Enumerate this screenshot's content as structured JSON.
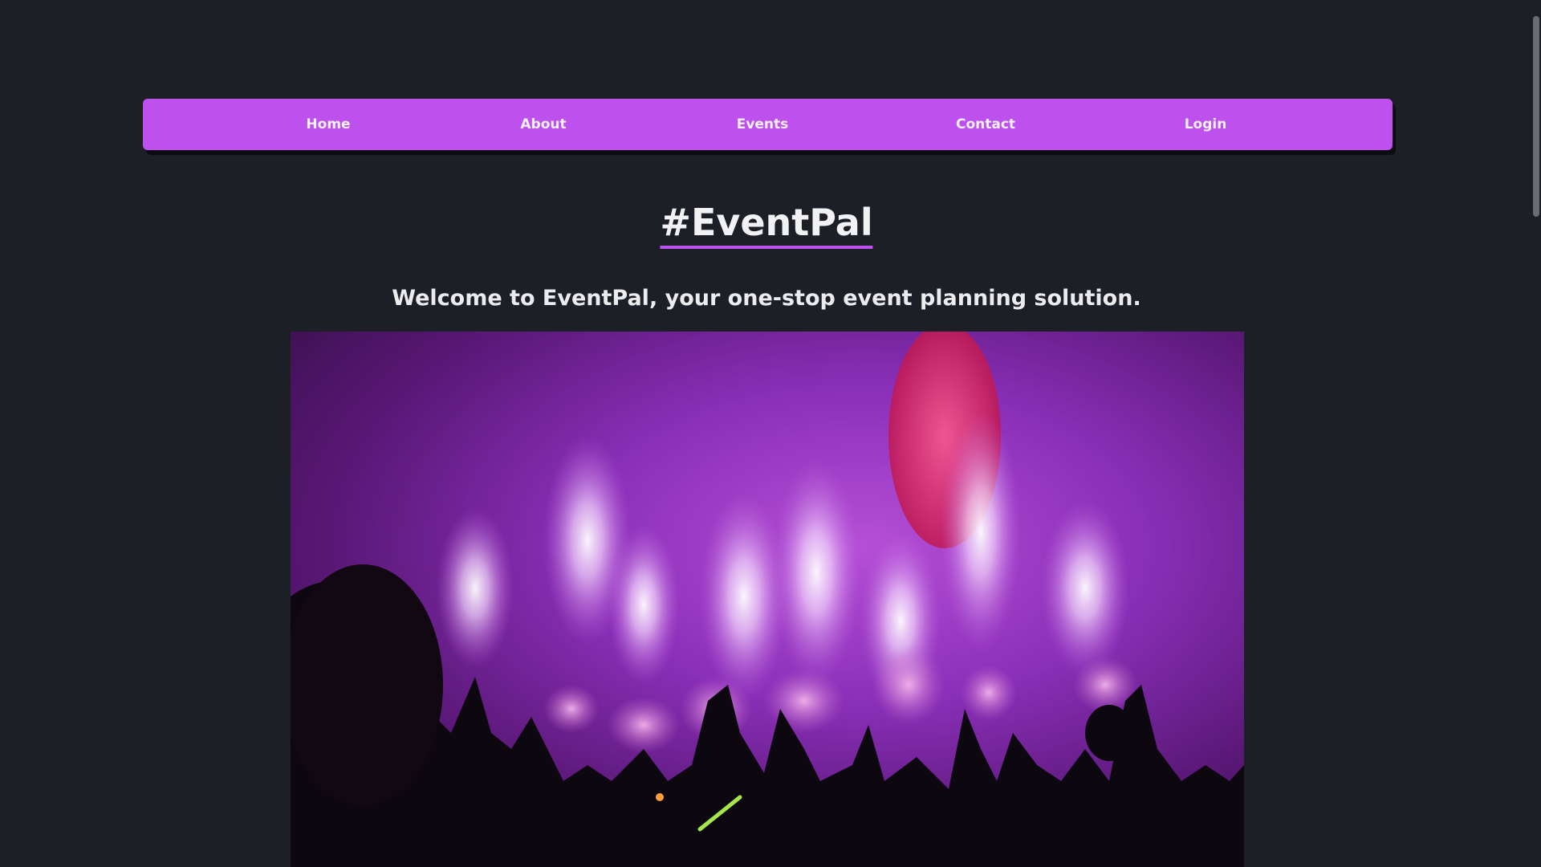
{
  "nav": {
    "items": [
      {
        "label": "Home"
      },
      {
        "label": "About"
      },
      {
        "label": "Events"
      },
      {
        "label": "Contact"
      },
      {
        "label": "Login"
      }
    ]
  },
  "hero": {
    "brand": "#EventPal",
    "tagline": "Welcome to EventPal, your one-stop event planning solution."
  },
  "colors": {
    "background": "#1d1f27",
    "accent": "#be51ee",
    "text": "#f2f2f4"
  }
}
